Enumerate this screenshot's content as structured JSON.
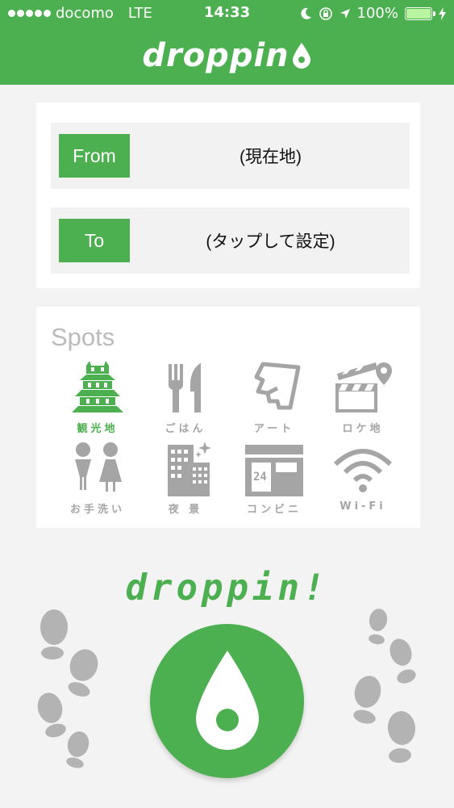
{
  "status_bar": {
    "carrier": "docomo",
    "network": "LTE",
    "time": "14:33",
    "battery": "100%"
  },
  "header": {
    "logo_text": "droppin"
  },
  "route": {
    "from_label": "From",
    "from_value": "(現在地)",
    "to_label": "To",
    "to_value": "(タップして設定)"
  },
  "spots": {
    "title": "Spots",
    "items": [
      {
        "label": "観光地",
        "icon": "castle-icon",
        "selected": true
      },
      {
        "label": "ごはん",
        "icon": "fork-knife-icon",
        "selected": false
      },
      {
        "label": "アート",
        "icon": "art-icon",
        "selected": false
      },
      {
        "label": "ロケ地",
        "icon": "clapperboard-pin-icon",
        "selected": false
      },
      {
        "label": "お手洗い",
        "icon": "restroom-icon",
        "selected": false
      },
      {
        "label": "夜 景",
        "icon": "night-buildings-icon",
        "selected": false
      },
      {
        "label": "コンビニ",
        "icon": "convenience-store-icon",
        "selected": false
      },
      {
        "label": "Wi-Fi",
        "icon": "wifi-icon",
        "selected": false
      }
    ]
  },
  "brand": {
    "tagline": "droppin!"
  },
  "colors": {
    "accent": "#4caf50",
    "inactive_icon": "#a5a5a5",
    "background": "#f3f3f3"
  }
}
